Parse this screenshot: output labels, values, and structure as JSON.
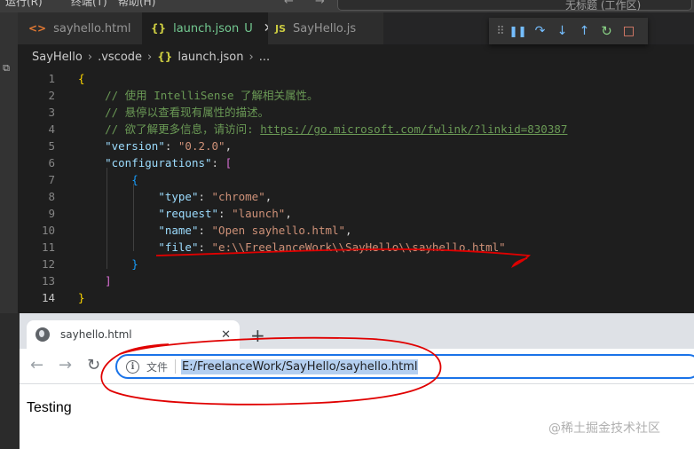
{
  "vscode": {
    "menu": [
      "运行(R)",
      "终端(T)",
      "帮助(H)"
    ],
    "nav_arrows": "← →",
    "command_center": "无标题 (工作区)",
    "explorer_icon": "files-icon",
    "tabs": [
      {
        "icon": "<>",
        "label": "sayhello.html"
      },
      {
        "icon": "{}",
        "label": "launch.json",
        "badge": "U",
        "close": "✕"
      },
      {
        "icon": "JS",
        "label": "SayHello.js"
      }
    ],
    "debug_toolbar": {
      "grip": "⠿",
      "continue": "❚❚",
      "step_over": "↷",
      "step_into": "↓",
      "step_out": "↑",
      "restart": "↻",
      "stop": "□"
    },
    "breadcrumb": {
      "items": [
        "SayHello",
        ".vscode",
        "launch.json",
        "..."
      ],
      "separator": "›",
      "json_icon": "{}"
    },
    "lines": [
      {
        "n": "1",
        "parts": [
          {
            "t": "{",
            "c": "c-brace"
          }
        ]
      },
      {
        "n": "2",
        "parts": [
          {
            "t": "    // 使用 IntelliSense 了解相关属性。",
            "c": "c-comment"
          }
        ]
      },
      {
        "n": "3",
        "parts": [
          {
            "t": "    // 悬停以查看现有属性的描述。",
            "c": "c-comment"
          }
        ]
      },
      {
        "n": "4",
        "parts": [
          {
            "t": "    // 欲了解更多信息，请访问: ",
            "c": "c-comment"
          },
          {
            "t": "https://go.microsoft.com/fwlink/?linkid=830387",
            "c": "c-link"
          }
        ]
      },
      {
        "n": "5",
        "parts": [
          {
            "t": "    ",
            "c": "c-punc"
          },
          {
            "t": "\"version\"",
            "c": "c-key"
          },
          {
            "t": ": ",
            "c": "c-punc"
          },
          {
            "t": "\"0.2.0\"",
            "c": "c-str"
          },
          {
            "t": ",",
            "c": "c-punc"
          }
        ]
      },
      {
        "n": "6",
        "parts": [
          {
            "t": "    ",
            "c": "c-punc"
          },
          {
            "t": "\"configurations\"",
            "c": "c-key"
          },
          {
            "t": ": ",
            "c": "c-punc"
          },
          {
            "t": "[",
            "c": "c-bracket"
          }
        ]
      },
      {
        "n": "7",
        "parts": [
          {
            "t": "        ",
            "c": "c-punc"
          },
          {
            "t": "{",
            "c": "c-brace2"
          }
        ]
      },
      {
        "n": "8",
        "parts": [
          {
            "t": "            ",
            "c": "c-punc"
          },
          {
            "t": "\"type\"",
            "c": "c-key"
          },
          {
            "t": ": ",
            "c": "c-punc"
          },
          {
            "t": "\"chrome\"",
            "c": "c-str"
          },
          {
            "t": ",",
            "c": "c-punc"
          }
        ]
      },
      {
        "n": "9",
        "parts": [
          {
            "t": "            ",
            "c": "c-punc"
          },
          {
            "t": "\"request\"",
            "c": "c-key"
          },
          {
            "t": ": ",
            "c": "c-punc"
          },
          {
            "t": "\"launch\"",
            "c": "c-str"
          },
          {
            "t": ",",
            "c": "c-punc"
          }
        ]
      },
      {
        "n": "10",
        "parts": [
          {
            "t": "            ",
            "c": "c-punc"
          },
          {
            "t": "\"name\"",
            "c": "c-key"
          },
          {
            "t": ": ",
            "c": "c-punc"
          },
          {
            "t": "\"Open sayhello.html\"",
            "c": "c-str"
          },
          {
            "t": ",",
            "c": "c-punc"
          }
        ]
      },
      {
        "n": "11",
        "parts": [
          {
            "t": "            ",
            "c": "c-punc"
          },
          {
            "t": "\"file\"",
            "c": "c-key"
          },
          {
            "t": ": ",
            "c": "c-punc"
          },
          {
            "t": "\"e:\\\\FreelanceWork\\\\SayHello\\\\sayhello.html\"",
            "c": "c-str"
          }
        ]
      },
      {
        "n": "12",
        "parts": [
          {
            "t": "        ",
            "c": "c-punc"
          },
          {
            "t": "}",
            "c": "c-brace2"
          }
        ]
      },
      {
        "n": "13",
        "parts": [
          {
            "t": "    ",
            "c": "c-punc"
          },
          {
            "t": "]",
            "c": "c-bracket"
          }
        ]
      },
      {
        "n": "14",
        "parts": [
          {
            "t": "}",
            "c": "c-brace"
          }
        ]
      }
    ],
    "current_line": "14"
  },
  "browser": {
    "tab_title": "sayhello.html",
    "tab_close": "✕",
    "new_tab": "+",
    "back": "←",
    "forward": "→",
    "reload": "↻",
    "info_icon": "i",
    "file_label": "文件",
    "url": "E:/FreelanceWork/SayHello/sayhello.html",
    "page_text": "Testing"
  },
  "watermark": "@稀土掘金技术社区",
  "colors": {
    "annotation": "#e00000",
    "selection": "#b4cff0",
    "focus_ring": "#1a73e8"
  }
}
